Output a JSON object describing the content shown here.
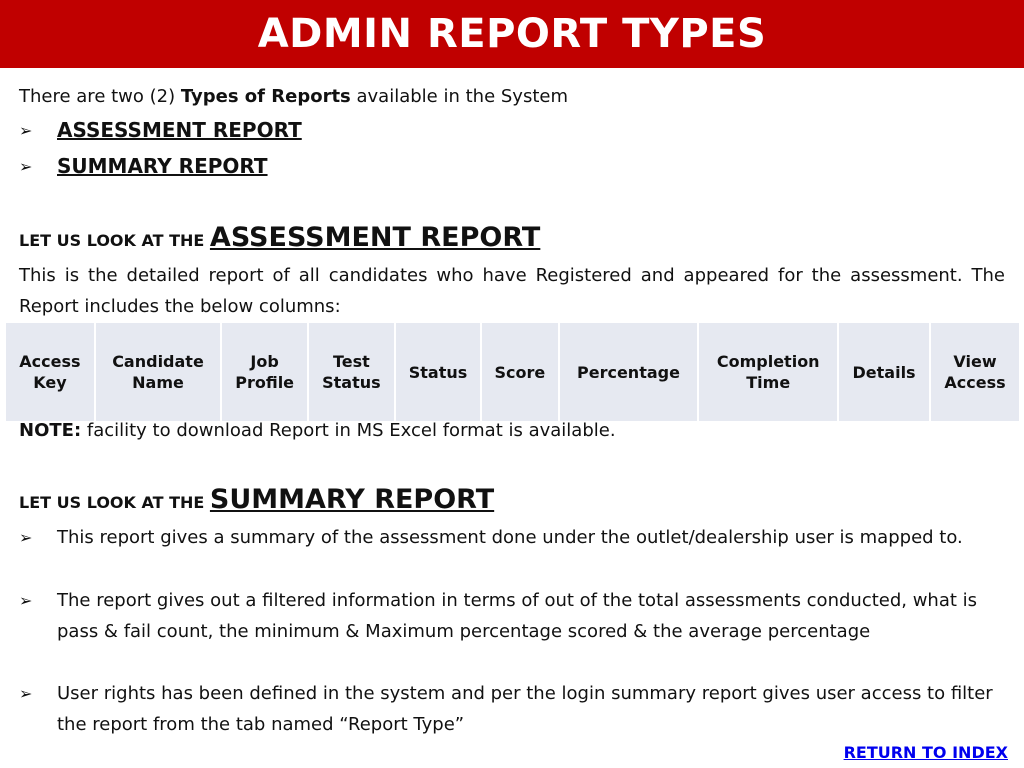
{
  "header": {
    "title": "ADMIN REPORT TYPES",
    "color": "#c00000"
  },
  "intro": {
    "prefix": "There are two (2) ",
    "bold": "Types of Reports",
    "suffix": " available in the System",
    "bullet_icon": "arrow-bullet",
    "items": [
      "ASSESSMENT REPORT",
      "SUMMARY REPORT"
    ]
  },
  "assessment": {
    "lead": "LET US LOOK AT THE ",
    "title": "ASSESSMENT REPORT",
    "description": "This is the detailed report of all candidates who have Registered and appeared for the assessment. The Report includes the below columns:",
    "columns": [
      [
        "Access",
        "Key"
      ],
      [
        "Candidate",
        "Name"
      ],
      [
        "Job",
        "Profile"
      ],
      [
        "Test",
        "Status"
      ],
      [
        "Status"
      ],
      [
        "Score"
      ],
      [
        "Percentage"
      ],
      [
        "Completion",
        "Time"
      ],
      [
        "Details"
      ],
      [
        "View",
        "Access"
      ]
    ],
    "note_label": "NOTE:",
    "note_text": " facility to download Report in MS Excel format is available."
  },
  "summary": {
    "lead": "LET US LOOK AT THE ",
    "title": "SUMMARY REPORT",
    "bullets": [
      "This report gives a summary of the assessment done under the outlet/dealership user is mapped to.",
      "The report gives out a filtered information in terms of out of the total assessments conducted, what is pass & fail count, the minimum & Maximum percentage scored & the average percentage",
      "User rights has been defined in the system and per the login summary report gives user access to filter the report from the tab named “Report Type”"
    ]
  },
  "footer": {
    "return_link": "RETURN TO INDEX",
    "link_color": "#0000ee"
  }
}
